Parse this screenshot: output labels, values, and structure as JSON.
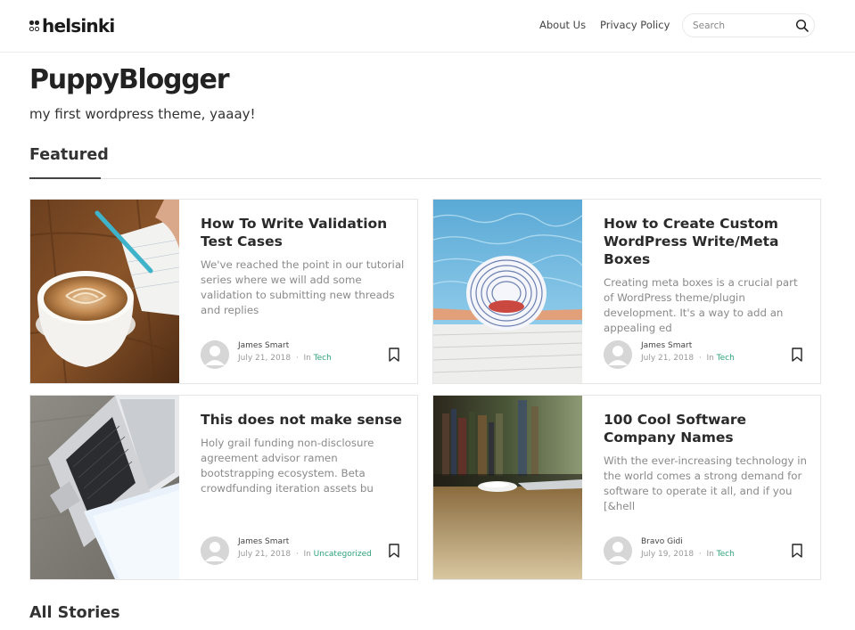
{
  "header": {
    "logo_text": "helsinki",
    "nav": [
      {
        "label": "About Us"
      },
      {
        "label": "Privacy Policy"
      }
    ],
    "search": {
      "placeholder": "Search"
    }
  },
  "site": {
    "title": "PuppyBlogger",
    "tagline": "my first wordpress theme, yaaay!"
  },
  "sections": {
    "featured": "Featured",
    "all_stories": "All Stories"
  },
  "posts": [
    {
      "title": "How To Write Validation Test Cases",
      "excerpt": "We've reached the point in our tutorial series where we will add some validation to submitting new threads and replies",
      "author": "James Smart",
      "date": "July 21, 2018",
      "in": "In",
      "category": "Tech"
    },
    {
      "title": "How to Create Custom WordPress Write/Meta Boxes",
      "excerpt": "Creating meta boxes is a crucial part of WordPress theme/plugin development. It's a way to add an appealing ed",
      "author": "James Smart",
      "date": "July 21, 2018",
      "in": "In",
      "category": "Tech"
    },
    {
      "title": "This does not make sense",
      "excerpt": "Holy grail funding non-disclosure agreement advisor ramen bootstrapping ecosystem. Beta crowdfunding iteration assets bu",
      "author": "James Smart",
      "date": "July 21, 2018",
      "in": "In",
      "category": "Uncategorized"
    },
    {
      "title": "100 Cool Software Company Names",
      "excerpt": "With the ever-increasing technology in the world comes a strong demand for software to operate it all, and if you [&hell",
      "author": "Bravo Gidi",
      "date": "July 19, 2018",
      "in": "In",
      "category": "Tech"
    }
  ],
  "colors": {
    "category_link": "#2fa37a",
    "excerpt": "#8a8a8a"
  },
  "icons": {
    "search": "search-icon",
    "bookmark": "bookmark-icon",
    "avatar": "user-avatar"
  }
}
